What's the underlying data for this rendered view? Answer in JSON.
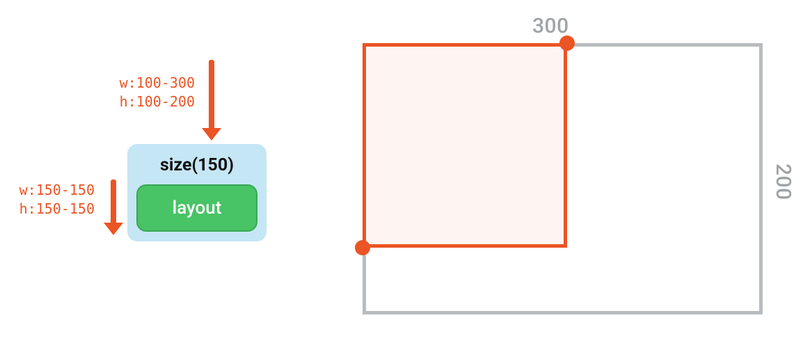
{
  "left": {
    "incoming_constraints": {
      "w": "w:100-300",
      "h": "h:100-200"
    },
    "card": {
      "title": "size(150)",
      "child_label": "layout"
    },
    "outgoing_constraints": {
      "w": "w:150-150",
      "h": "h:150-150"
    }
  },
  "right": {
    "parent_width_label": "300",
    "parent_height_label": "200"
  },
  "colors": {
    "accent_orange": "#eb5424",
    "accent_green": "#48c365",
    "card_blue": "#c5e6f4",
    "muted_gray": "#b9bcbf"
  }
}
